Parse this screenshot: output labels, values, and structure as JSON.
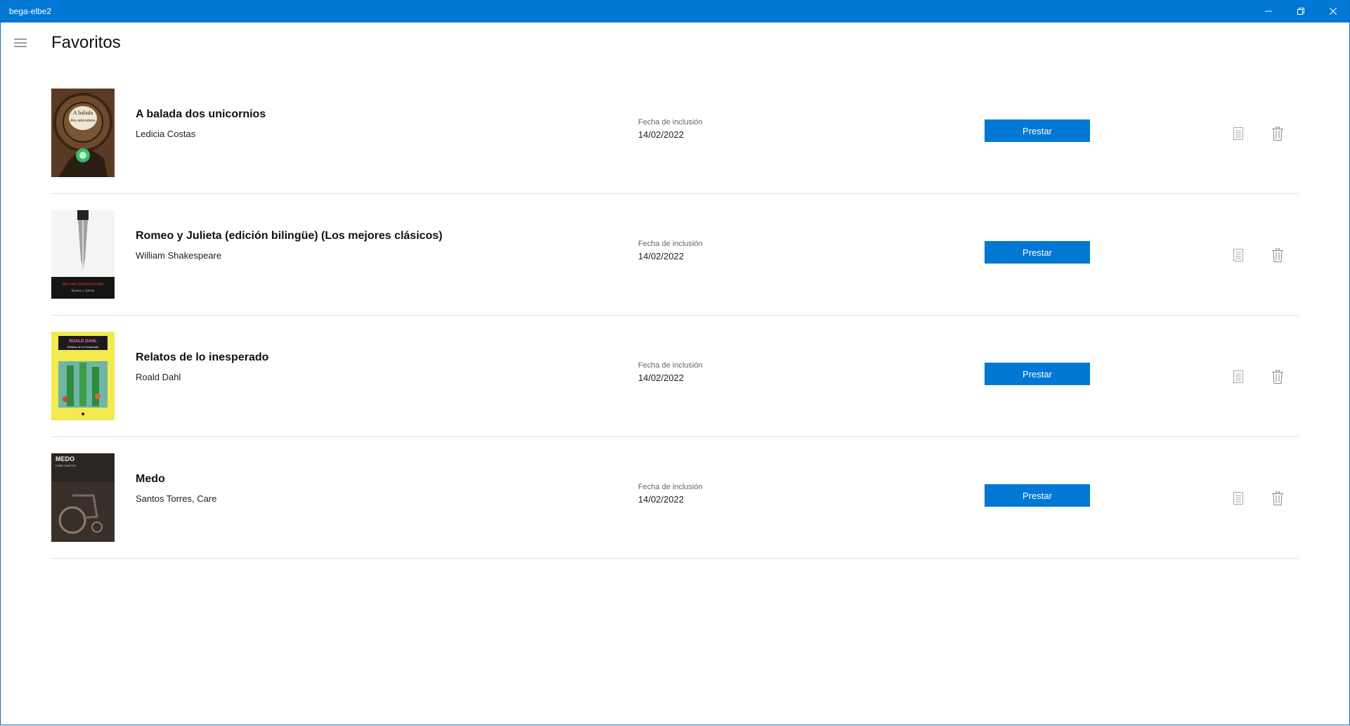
{
  "window": {
    "title": "bega-elbe2",
    "controls": {
      "minimize": "minimize-icon",
      "maximize": "restore-icon",
      "close": "close-icon"
    }
  },
  "header": {
    "menu_icon": "hamburger-icon",
    "title": "Favoritos"
  },
  "colors": {
    "accent": "#0078d4",
    "divider": "#e1e1e1",
    "icon_gray": "#9a9a9a"
  },
  "favorites": [
    {
      "title": "A balada dos unicornios",
      "author": "Ledicia Costas",
      "date_label": "Fecha de inclusión",
      "date": "14/02/2022",
      "lend_label": "Prestar",
      "cover_text": "A balada dos unicornios"
    },
    {
      "title": "Romeo y Julieta (edición bilingüe) (Los mejores clásicos)",
      "author": "William Shakespeare",
      "date_label": "Fecha de inclusión",
      "date": "14/02/2022",
      "lend_label": "Prestar",
      "cover_text": "WILLIAM SHAKESPEARE"
    },
    {
      "title": "Relatos de lo inesperado",
      "author": "Roald Dahl",
      "date_label": "Fecha de inclusión",
      "date": "14/02/2022",
      "lend_label": "Prestar",
      "cover_text": "ROALD DAHL"
    },
    {
      "title": "Medo",
      "author": "Santos Torres, Care",
      "date_label": "Fecha de inclusión",
      "date": "14/02/2022",
      "lend_label": "Prestar",
      "cover_text": "MEDO"
    }
  ],
  "row_icons": {
    "details": "document-icon",
    "delete": "trash-icon"
  }
}
